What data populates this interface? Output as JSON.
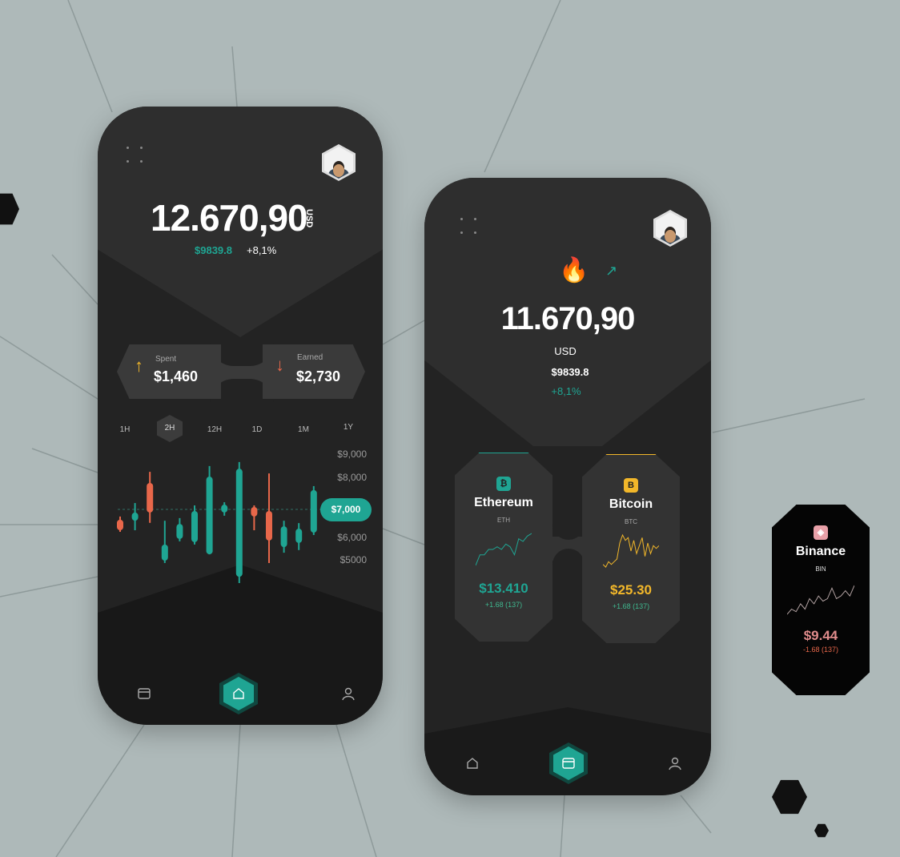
{
  "colors": {
    "accent": "#1fa593",
    "red": "#e8674a",
    "gold": "#f2b72a",
    "background": "#aeb9b9"
  },
  "left_phone": {
    "balance": "12.670,90",
    "currency": "USD",
    "sub_amount": "$9839.8",
    "change": "+8,1%",
    "spent": {
      "label": "Spent",
      "value": "$1,460",
      "icon": "arrow-up-icon"
    },
    "earned": {
      "label": "Earned",
      "value": "$2,730",
      "icon": "arrow-down-icon"
    },
    "tabs": [
      "1H",
      "2H",
      "12H",
      "1D",
      "1M",
      "1Y"
    ],
    "active_tab": "2H",
    "nav": [
      "wallet-icon",
      "home-icon",
      "user-icon"
    ]
  },
  "chart_data": {
    "type": "candlestick",
    "yticks": [
      "$9,000",
      "$8,000",
      "$6,000",
      "$5000"
    ],
    "current_label": "$7,000",
    "current_value": 7000,
    "ylim": [
      5000,
      9000
    ],
    "candles": [
      {
        "o": 6520,
        "c": 6120,
        "h": 6640,
        "l": 6060
      },
      {
        "o": 6480,
        "c": 6790,
        "h": 7150,
        "l": 6120
      },
      {
        "o": 7910,
        "c": 6790,
        "h": 8330,
        "l": 6400
      },
      {
        "o": 4970,
        "c": 5580,
        "h": 6480,
        "l": 4880
      },
      {
        "o": 5790,
        "c": 6360,
        "h": 6580,
        "l": 5700
      },
      {
        "o": 5670,
        "c": 6850,
        "h": 7060,
        "l": 5580
      },
      {
        "o": 5210,
        "c": 8150,
        "h": 8550,
        "l": 5210
      },
      {
        "o": 6790,
        "c": 7090,
        "h": 7180,
        "l": 6670
      },
      {
        "o": 4360,
        "c": 8450,
        "h": 8700,
        "l": 4120
      },
      {
        "o": 7000,
        "c": 6640,
        "h": 7060,
        "l": 6120
      },
      {
        "o": 6850,
        "c": 5730,
        "h": 8270,
        "l": 4880
      },
      {
        "o": 5480,
        "c": 6270,
        "h": 6480,
        "l": 5270
      },
      {
        "o": 5640,
        "c": 6180,
        "h": 6390,
        "l": 5370
      },
      {
        "o": 6030,
        "c": 7640,
        "h": 7790,
        "l": 5940
      }
    ]
  },
  "right_phone": {
    "balance": "11.670,90",
    "currency": "USD",
    "sub_amount": "$9839.8",
    "change": "+8,1%",
    "emoji": "🔥",
    "trend_arrow": "↗",
    "cards": [
      {
        "name": "Ethereum",
        "symbol": "ETH",
        "price": "$13.410",
        "change": "+1.68 (137)",
        "color": "#1fa593",
        "icon": "₿",
        "spark": [
          2,
          6,
          6,
          8,
          8,
          9,
          8,
          10,
          9,
          6,
          12,
          11,
          13,
          14
        ]
      },
      {
        "name": "Bitcoin",
        "symbol": "BTC",
        "price": "$25.30",
        "change": "+1.68 (137)",
        "color": "#f2b72a",
        "icon": "B",
        "spark": [
          2,
          1,
          3,
          2,
          3,
          4,
          10,
          13,
          11,
          12,
          7,
          11,
          6,
          9,
          12,
          5,
          10,
          6,
          9,
          8,
          9
        ]
      }
    ],
    "nav": [
      "home-icon",
      "wallet-icon",
      "user-icon"
    ]
  },
  "binance": {
    "name": "Binance",
    "symbol": "BIN",
    "price": "$9.44",
    "change": "-1.68 (137)",
    "color": "#e08c8c",
    "spark": [
      2,
      4,
      3,
      6,
      4,
      8,
      6,
      9,
      7,
      8,
      12,
      8,
      9,
      11,
      9,
      13
    ]
  }
}
